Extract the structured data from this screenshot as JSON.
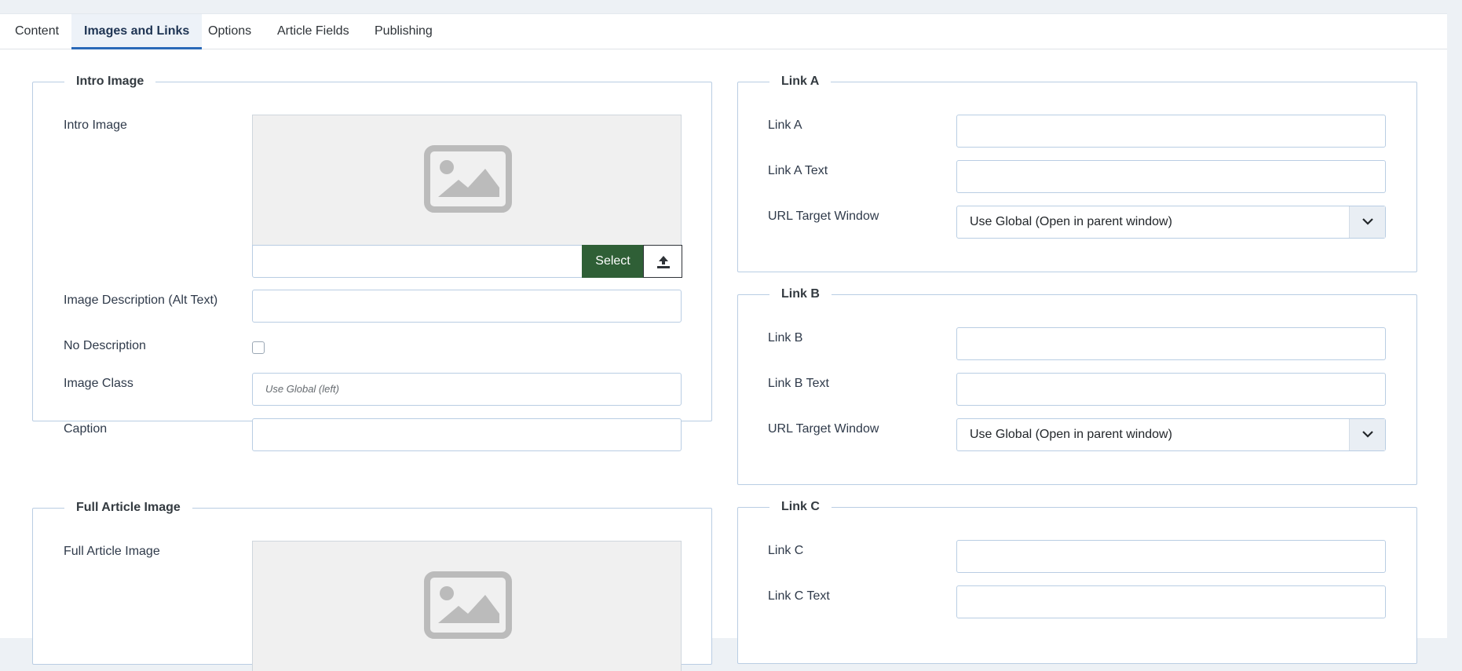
{
  "tabs": [
    {
      "label": "Content"
    },
    {
      "label": "Images and Links"
    },
    {
      "label": "Options"
    },
    {
      "label": "Article Fields"
    },
    {
      "label": "Publishing"
    }
  ],
  "active_tab": "Images and Links",
  "intro_image": {
    "legend": "Intro Image",
    "image_label": "Intro Image",
    "select_button": "Select",
    "alt_label": "Image Description (Alt Text)",
    "no_desc_label": "No Description",
    "no_desc_checked": false,
    "class_label": "Image Class",
    "class_placeholder": "Use Global (left)",
    "caption_label": "Caption"
  },
  "full_image": {
    "legend": "Full Article Image",
    "image_label": "Full Article Image"
  },
  "link_a": {
    "legend": "Link A",
    "link_label": "Link A",
    "text_label": "Link A Text",
    "target_label": "URL Target Window",
    "target_value": "Use Global (Open in parent window)"
  },
  "link_b": {
    "legend": "Link B",
    "link_label": "Link B",
    "text_label": "Link B Text",
    "target_label": "URL Target Window",
    "target_value": "Use Global (Open in parent window)"
  },
  "link_c": {
    "legend": "Link C",
    "link_label": "Link C",
    "text_label": "Link C Text"
  },
  "colors": {
    "accent": "#2a69b8",
    "select_button": "#2f5f36",
    "border": "#b9cde3",
    "page_bg": "#edf1f5"
  },
  "icons": {
    "image_placeholder": "image-placeholder-icon",
    "upload": "upload-icon",
    "chevron": "chevron-down-icon"
  }
}
